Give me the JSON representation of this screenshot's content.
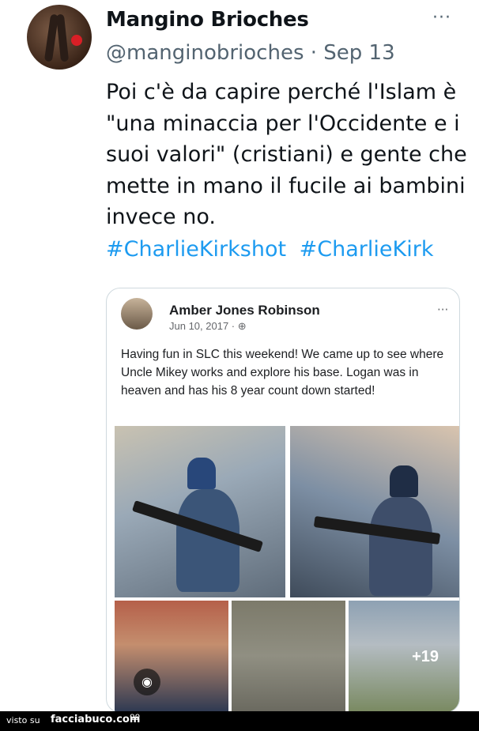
{
  "tweet": {
    "name": "Mangino Brioches",
    "handle_date": "@manginobrioches · Sep 13",
    "more": "···",
    "body": "Poi c'è da capire perché l'Islam è \"una minaccia per l'Occidente e i suoi valori\" (cristiani) e gente che mette in mano il fucile ai bambini invece no.",
    "hashtags": [
      "#CharlieKirkshot",
      "#CharlieKirk"
    ]
  },
  "embedded": {
    "name": "Amber Jones Robinson",
    "date": "Jun 10, 2017 · ⊕",
    "more": "···",
    "text": "Having fun in SLC this weekend! We came up to see where Uncle Mikey works and explore his base. Logan was in heaven and has his 8 year count down started!",
    "more_photos": "+19"
  },
  "footer": {
    "visto": "visto su",
    "site": "facciabuco.com",
    "emoji": "ºº"
  }
}
